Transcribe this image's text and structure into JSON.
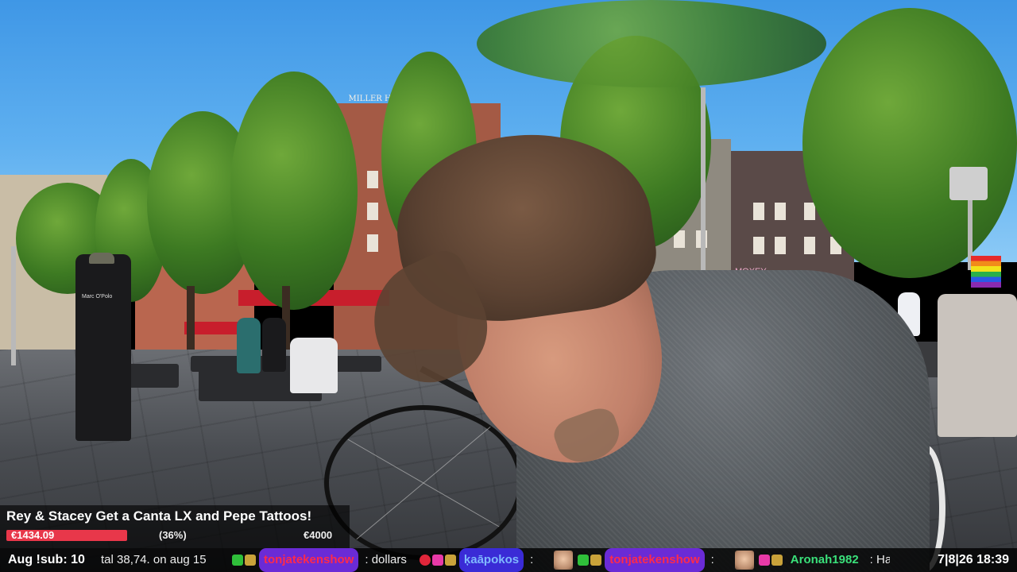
{
  "stream": {
    "goal": {
      "title": "Rey & Stacey Get a Canta LX and Pepe Tattoos!",
      "current": "€1434.09",
      "percent": "(36%)",
      "target": "€4000",
      "progress_fraction": 0.36
    },
    "ticker": {
      "sub_count": "Aug !sub: 10",
      "sub_text": "tal 38,74. on aug 15",
      "chat": [
        {
          "user": "tonjatekenshow",
          "message": ": dollars"
        },
        {
          "user": "ķaāpokos",
          "message": ":"
        },
        {
          "user": "tonjatekenshow",
          "message": ":"
        },
        {
          "user": "Aronah1982",
          "message": ": Haha"
        }
      ],
      "clock": "7|8|26 18:39"
    },
    "scene": {
      "storefront_sign": "MILLER HOTEL",
      "shop_sign": "MOXEY",
      "shirt_text": "Marc O'Polo"
    },
    "colors": {
      "goal_bar": "#e8374a",
      "username_badge_purple": "#6a2bd6",
      "username_text_red": "#ff2a4a",
      "username_text_green": "#3ae07a"
    }
  }
}
